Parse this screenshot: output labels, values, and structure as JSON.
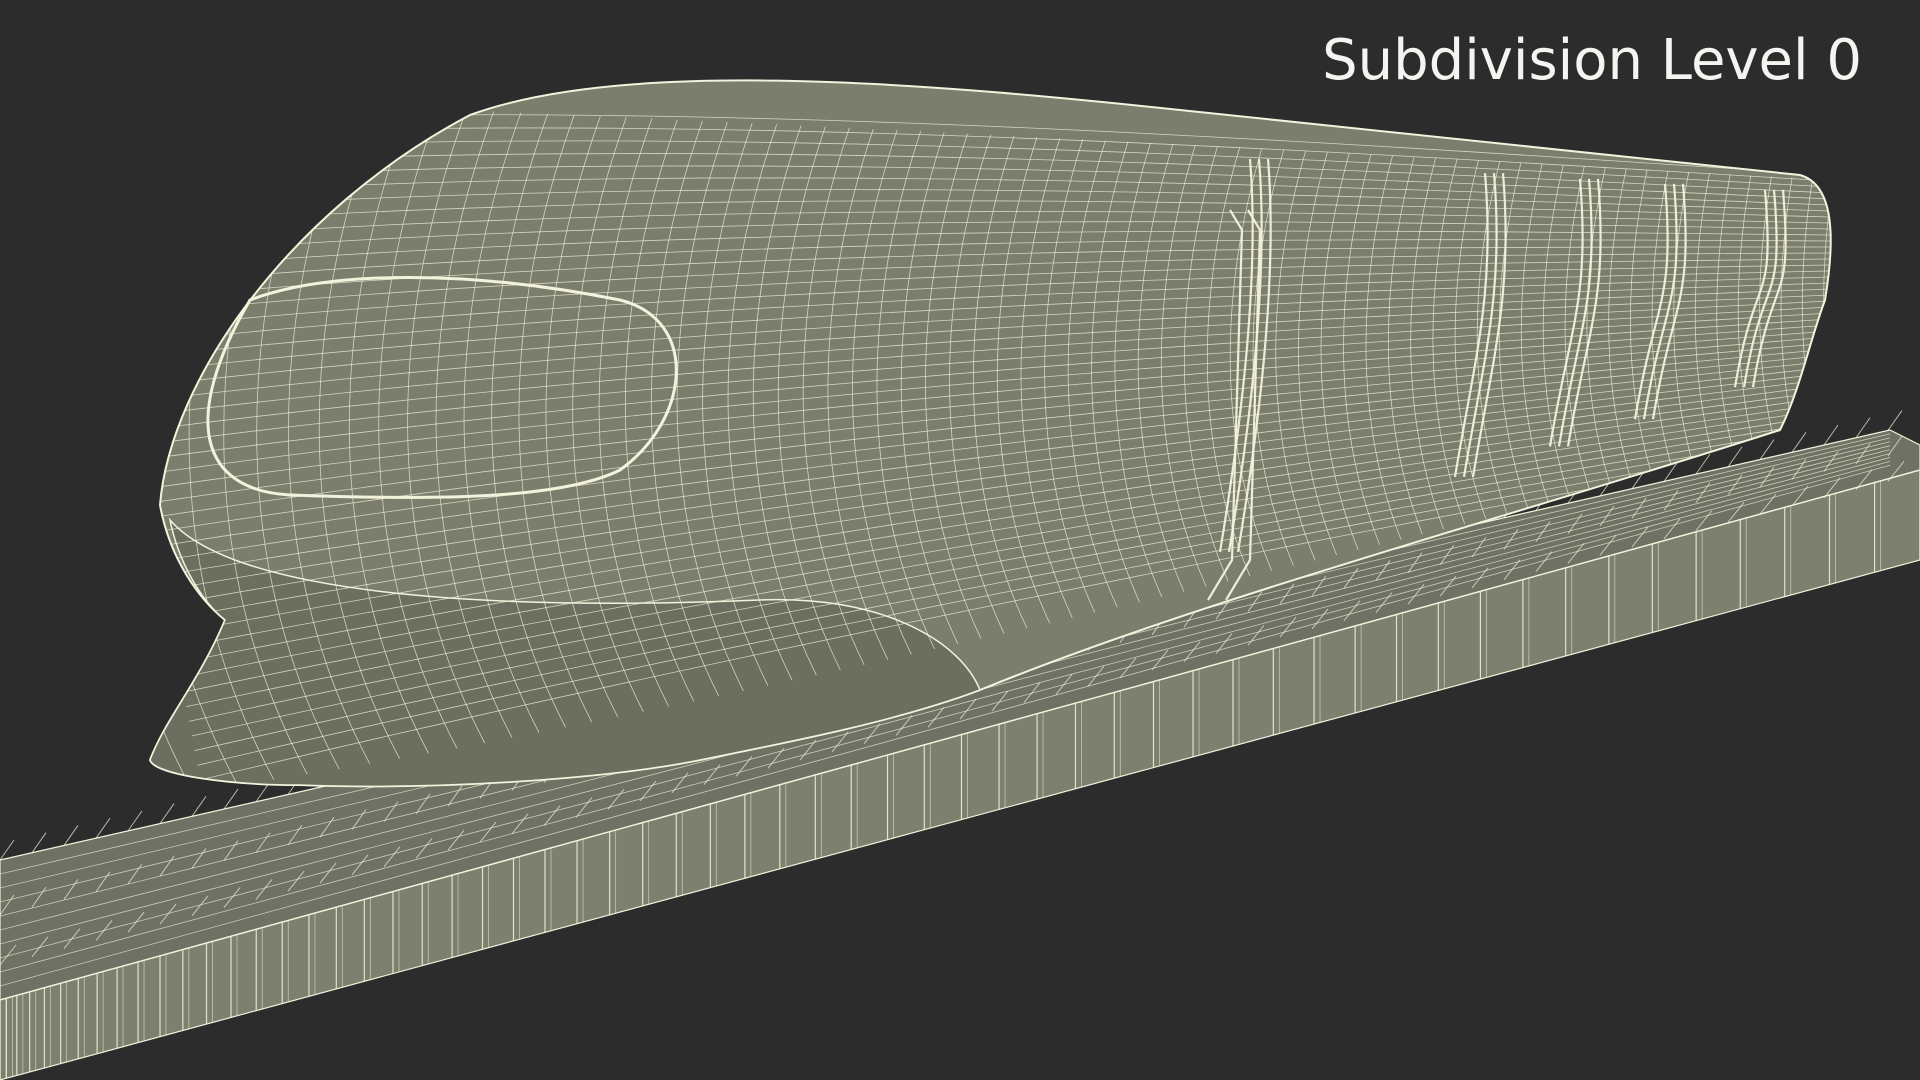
{
  "overlay": {
    "label": "Subdivision Level 0"
  },
  "scene": {
    "render_mode": "wireframe-on-shaded",
    "background_color": "#2b2c2b",
    "surface_color": "#7b7e6c",
    "surface_dark_color": "#5f6255",
    "wire_color": "#f3f2dc",
    "subject": "maglev-train-on-track"
  }
}
